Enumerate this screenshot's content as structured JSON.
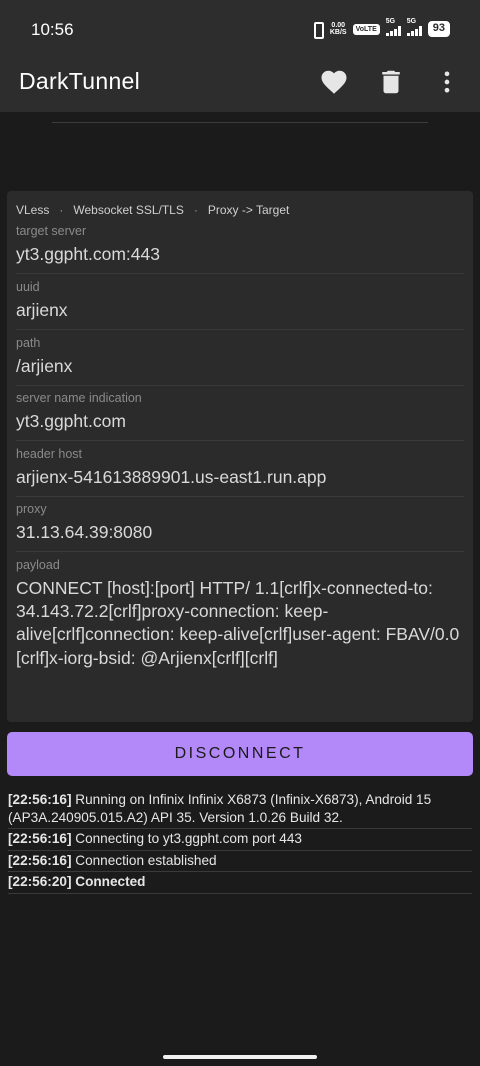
{
  "status_bar": {
    "time": "10:56",
    "net_speed_value": "0.00",
    "net_speed_unit": "KB/S",
    "volte": "VoLTE",
    "sim1_label": "5G",
    "sim2_label": "5G",
    "battery": "93"
  },
  "app_bar": {
    "title": "DarkTunnel",
    "icons": [
      "heart-icon",
      "trash-icon",
      "more-vert-icon"
    ]
  },
  "config": {
    "protocol": "VLess",
    "transport": "Websocket SSL/TLS",
    "mode": "Proxy -> Target",
    "separator": "·",
    "fields": [
      {
        "label": "target server",
        "value": "yt3.ggpht.com:443"
      },
      {
        "label": "uuid",
        "value": "arjienx"
      },
      {
        "label": "path",
        "value": "/arjienx"
      },
      {
        "label": "server name indication",
        "value": "yt3.ggpht.com"
      },
      {
        "label": "header host",
        "value": "arjienx-541613889901.us-east1.run.app"
      },
      {
        "label": "proxy",
        "value": "31.13.64.39:8080"
      },
      {
        "label": "payload",
        "value": "CONNECT [host]:[port] HTTP/ 1.1[crlf]x-connected-to: 34.143.72.2[crlf]proxy-connection: keep-alive[crlf]connection: keep-alive[crlf]user-agent: FBAV/0.0 [crlf]x-iorg-bsid: @Arjienx[crlf][crlf]"
      }
    ]
  },
  "disconnect_label": "DISCONNECT",
  "log": [
    {
      "time": "[22:56:16]",
      "message": "Running on Infinix Infinix X6873 (Infinix-X6873), Android 15 (AP3A.240905.015.A2) API 35. Version 1.0.26 Build 32."
    },
    {
      "time": "[22:56:16]",
      "message": "Connecting to yt3.ggpht.com port 443"
    },
    {
      "time": "[22:56:16]",
      "message": "Connection established"
    },
    {
      "time": "[22:56:20]",
      "message": "Connected"
    }
  ],
  "colors": {
    "background": "#1b1b1b",
    "app_bar": "#2d2d2d",
    "card": "#2b2b2b",
    "accent": "#b388f8"
  }
}
